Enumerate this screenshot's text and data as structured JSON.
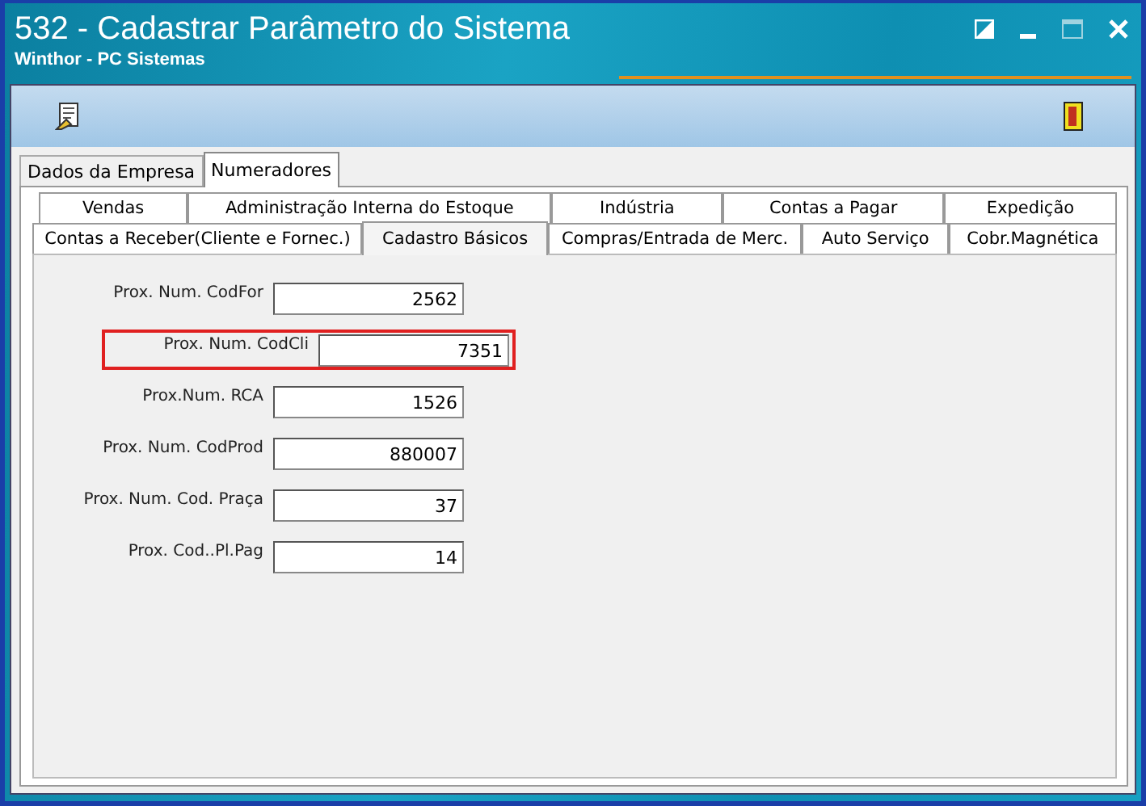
{
  "window": {
    "title": "532 - Cadastrar Parâmetro do Sistema",
    "subtitle": "Winthor - PC Sistemas"
  },
  "outer_tabs": [
    {
      "label": "Dados da Empresa",
      "selected": false
    },
    {
      "label": "Numeradores",
      "selected": true
    }
  ],
  "inner_tabs_row_1": [
    {
      "label": "Vendas",
      "selected": false
    },
    {
      "label": "Administração Interna do Estoque",
      "selected": false
    },
    {
      "label": "Indústria",
      "selected": false
    },
    {
      "label": "Contas a Pagar",
      "selected": false
    },
    {
      "label": "Expedição",
      "selected": false
    }
  ],
  "inner_tabs_row_2": [
    {
      "label": "Contas a Receber(Cliente e Fornec.)",
      "selected": false
    },
    {
      "label": "Cadastro Básicos",
      "selected": true
    },
    {
      "label": "Compras/Entrada de Merc.",
      "selected": false
    },
    {
      "label": "Auto Serviço",
      "selected": false
    },
    {
      "label": "Cobr.Magnética",
      "selected": false
    }
  ],
  "fields": [
    {
      "label": "Prox. Num. CodFor",
      "value": "2562",
      "highlighted": false
    },
    {
      "label": "Prox. Num. CodCli",
      "value": "7351",
      "highlighted": true
    },
    {
      "label": "Prox.Num. RCA",
      "value": "1526",
      "highlighted": false
    },
    {
      "label": "Prox. Num. CodProd",
      "value": "880007",
      "highlighted": false
    },
    {
      "label": "Prox. Num. Cod. Praça",
      "value": "37",
      "highlighted": false
    },
    {
      "label": "Prox. Cod..Pl.Pag",
      "value": "14",
      "highlighted": false
    }
  ]
}
